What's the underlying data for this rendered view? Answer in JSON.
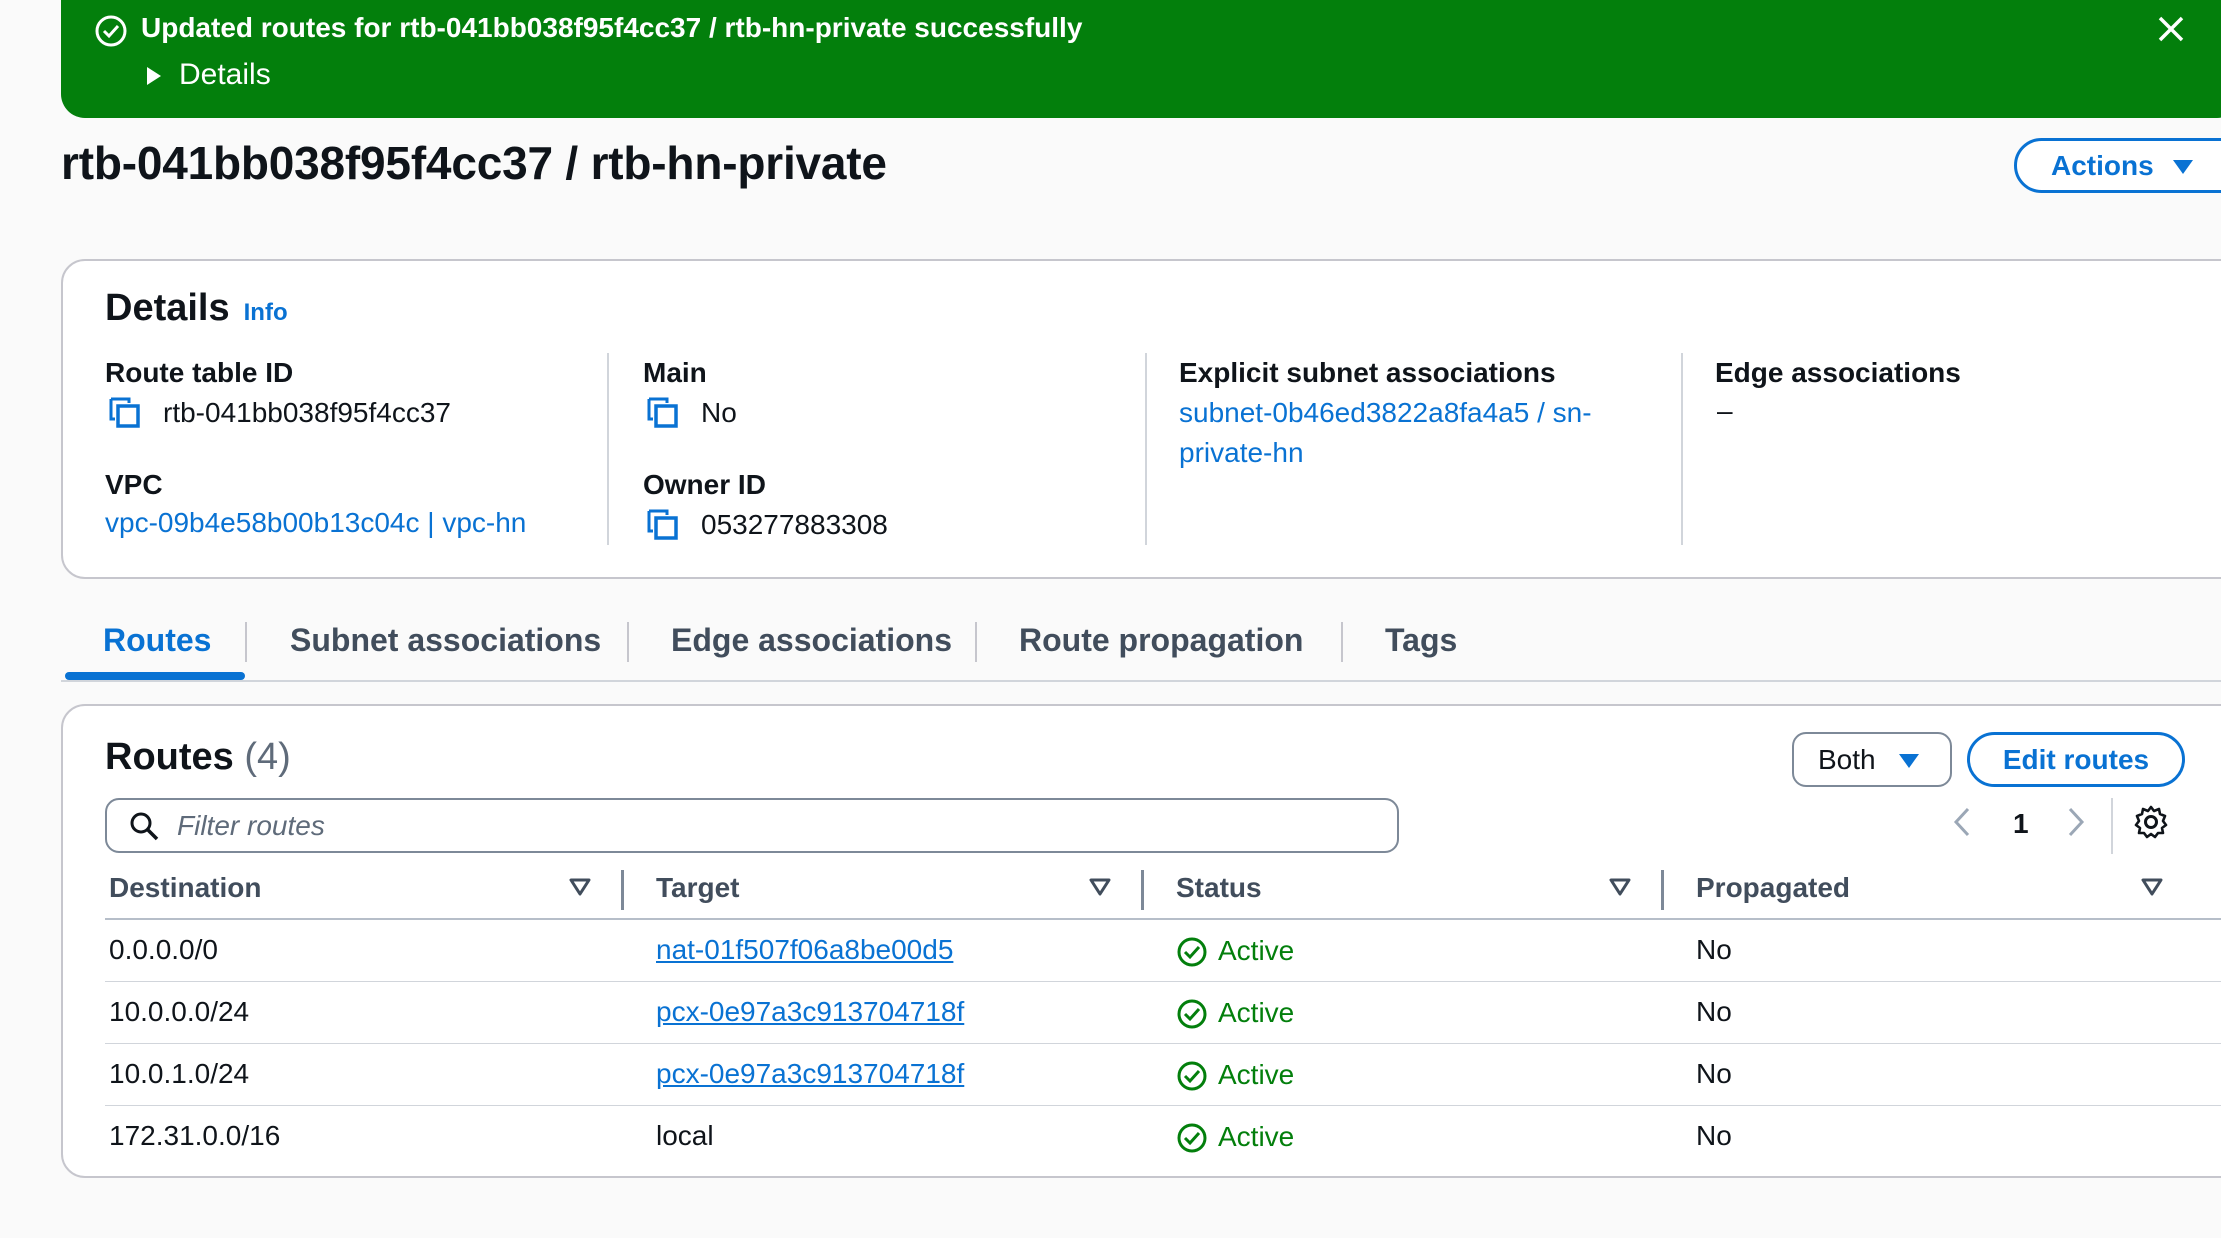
{
  "flash": {
    "message": "Updated routes for rtb-041bb038f95f4cc37 / rtb-hn-private successfully",
    "details_label": "Details",
    "color": "#037f0c",
    "icons": [
      "check-circle-icon",
      "caret-right-icon",
      "close-icon"
    ]
  },
  "page": {
    "title": "rtb-041bb038f95f4cc37 / rtb-hn-private",
    "actions_label": "Actions"
  },
  "details": {
    "title": "Details",
    "info_label": "Info",
    "route_table_id_label": "Route table ID",
    "route_table_id": "rtb-041bb038f95f4cc37",
    "main_label": "Main",
    "main_value": "No",
    "explicit_label": "Explicit subnet associations",
    "explicit_line1": "subnet-0b46ed3822a8fa4a5 / sn-",
    "explicit_line2": "private-hn",
    "edge_label": "Edge associations",
    "edge_value": "–",
    "vpc_label": "VPC",
    "vpc_value": "vpc-09b4e58b00b13c04c | vpc-hn",
    "owner_label": "Owner ID",
    "owner_value": "053277883308"
  },
  "tabs": [
    {
      "label": "Routes",
      "active": true
    },
    {
      "label": "Subnet associations",
      "active": false
    },
    {
      "label": "Edge associations",
      "active": false
    },
    {
      "label": "Route propagation",
      "active": false
    },
    {
      "label": "Tags",
      "active": false
    }
  ],
  "routes": {
    "title": "Routes",
    "count": "(4)",
    "filter_select": "Both",
    "edit_label": "Edit routes",
    "filter_placeholder": "Filter routes",
    "page_number": "1",
    "columns": [
      "Destination",
      "Target",
      "Status",
      "Propagated"
    ],
    "rows": [
      {
        "destination": "0.0.0.0/0",
        "target": "nat-01f507f06a8be00d5",
        "target_is_link": true,
        "status": "Active",
        "propagated": "No"
      },
      {
        "destination": "10.0.0.0/24",
        "target": "pcx-0e97a3c913704718f",
        "target_is_link": true,
        "status": "Active",
        "propagated": "No"
      },
      {
        "destination": "10.0.1.0/24",
        "target": "pcx-0e97a3c913704718f",
        "target_is_link": true,
        "status": "Active",
        "propagated": "No"
      },
      {
        "destination": "172.31.0.0/16",
        "target": "local",
        "target_is_link": false,
        "status": "Active",
        "propagated": "No"
      }
    ]
  },
  "colors": {
    "link": "#0972d3",
    "success": "#037f0c",
    "text": "#0f141a"
  }
}
